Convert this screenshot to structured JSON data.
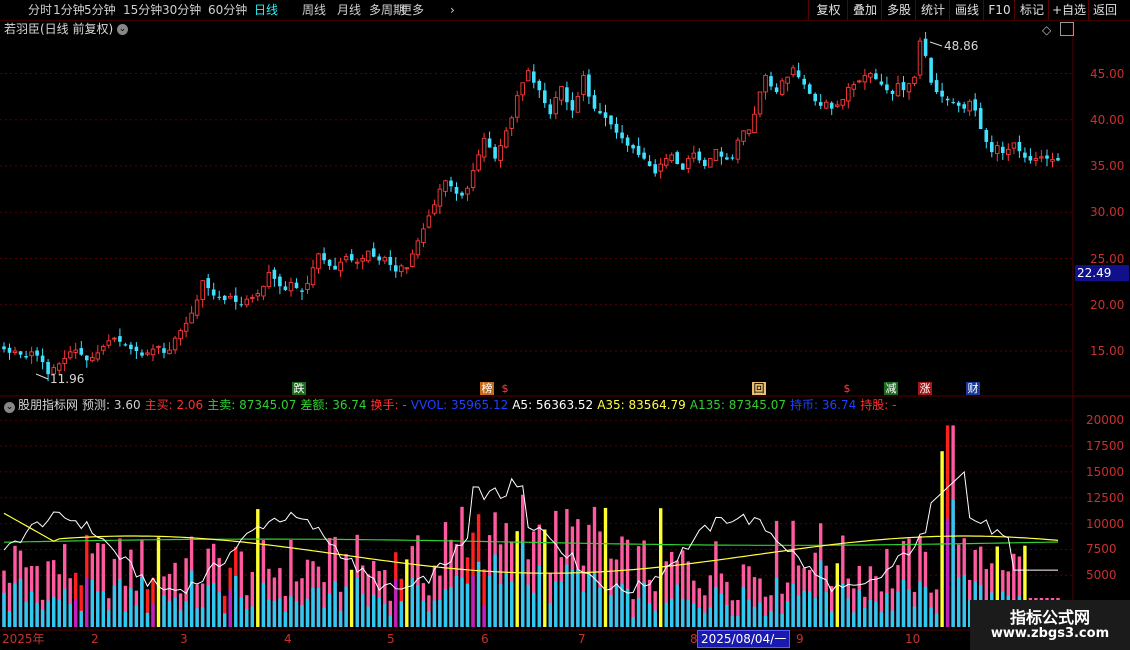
{
  "toolbar": {
    "left": [
      "分时",
      "1分钟",
      "5分钟",
      "15分钟",
      "30分钟",
      "60分钟",
      "日线",
      "周线",
      "月线",
      "多周期",
      "更多"
    ],
    "active": "日线",
    "right": [
      "复权",
      "叠加",
      "多股",
      "统计",
      "画线",
      "F10",
      "标记",
      "+自选",
      "返回"
    ]
  },
  "main_panel": {
    "title": "若羽臣(日线 前复权)",
    "y_ticks": [
      "45.00",
      "40.00",
      "35.00",
      "30.00",
      "25.00",
      "20.00",
      "15.00"
    ],
    "high_label": "48.86",
    "low_label": "11.96",
    "current_price": "22.49",
    "events": [
      {
        "text": "跌",
        "bg": "#1e6b1e",
        "fg": "#ffffff"
      },
      {
        "text": "榜",
        "bg": "#c46a1a",
        "fg": "#ffffff"
      },
      {
        "text": "$",
        "bg": "",
        "fg": "#ff4040"
      },
      {
        "text": "回",
        "bg": "#e8c070",
        "fg": "#000000"
      },
      {
        "text": "$",
        "bg": "",
        "fg": "#ff4040"
      },
      {
        "text": "减",
        "bg": "#1e6b1e",
        "fg": "#ffffff"
      },
      {
        "text": "涨",
        "bg": "#a01818",
        "fg": "#ffffff"
      },
      {
        "text": "财",
        "bg": "#1a3a9a",
        "fg": "#ffffff"
      }
    ]
  },
  "indicator_panel": {
    "name": "股朋指标网",
    "fields": [
      {
        "label": "预测:",
        "value": "3.60",
        "color": "#d0d0d0"
      },
      {
        "label": "主买:",
        "value": "2.06",
        "color": "#ff3030"
      },
      {
        "label": "主卖:",
        "value": "87345.07",
        "color": "#30d030"
      },
      {
        "label": "差额:",
        "value": "36.74",
        "color": "#30d030"
      },
      {
        "label": "换手:",
        "value": "-",
        "color": "#ff3030"
      },
      {
        "label": "VVOL:",
        "value": "35965.12",
        "color": "#2040ff"
      },
      {
        "label": "A5:",
        "value": "56363.52",
        "color": "#ffffff"
      },
      {
        "label": "A35:",
        "value": "83564.79",
        "color": "#ffff40"
      },
      {
        "label": "A135:",
        "value": "87345.07",
        "color": "#30d030"
      },
      {
        "label": "持币:",
        "value": "36.74",
        "color": "#2040ff"
      },
      {
        "label": "持股:",
        "value": "-",
        "color": "#ff3030"
      }
    ],
    "y_ticks": [
      "20000",
      "17500",
      "15000",
      "12500",
      "10000",
      "7500",
      "5000"
    ]
  },
  "x_axis": {
    "labels": [
      "2025年",
      "2",
      "3",
      "4",
      "5",
      "6",
      "7",
      "8",
      "9",
      "10"
    ],
    "cursor_date": "2025/08/04/一"
  },
  "watermark": {
    "line1": "指标公式网",
    "line2": "www.zbgs3.com"
  },
  "colors": {
    "up": "#ff3a3a",
    "down": "#40e0ff",
    "grid": "#5a0000",
    "axis_text": "#c83030"
  },
  "chart_data": {
    "type": "candlestick",
    "closes": [
      15.2,
      14.8,
      15.0,
      14.6,
      14.3,
      14.9,
      14.5,
      13.8,
      12.5,
      13.2,
      13.6,
      14.2,
      14.9,
      15.1,
      14.6,
      14.0,
      14.3,
      14.8,
      15.5,
      16.1,
      16.4,
      16.0,
      15.6,
      15.2,
      15.0,
      14.5,
      14.8,
      15.2,
      15.5,
      14.8,
      15.1,
      16.4,
      17.2,
      18.0,
      19.1,
      20.5,
      22.6,
      21.8,
      21.0,
      20.8,
      20.5,
      20.9,
      20.3,
      20.0,
      20.6,
      20.8,
      21.2,
      22.0,
      23.5,
      22.8,
      22.0,
      21.6,
      22.4,
      21.8,
      21.4,
      22.3,
      24.0,
      25.5,
      24.8,
      24.2,
      23.8,
      24.6,
      25.2,
      24.8,
      24.6,
      25.0,
      25.8,
      25.2,
      24.8,
      25.1,
      24.3,
      23.6,
      24.2,
      24.0,
      25.5,
      26.9,
      28.2,
      29.6,
      30.8,
      32.5,
      33.4,
      32.8,
      32.0,
      31.8,
      32.6,
      34.5,
      36.2,
      38.0,
      37.0,
      35.8,
      37.2,
      38.8,
      40.2,
      42.6,
      44.0,
      45.3,
      44.0,
      43.2,
      41.8,
      40.6,
      42.4,
      43.6,
      41.9,
      41.0,
      42.5,
      44.8,
      42.5,
      41.2,
      40.7,
      40.2,
      39.5,
      38.6,
      38.0,
      37.2,
      36.9,
      36.2,
      35.8,
      35.0,
      34.2,
      35.2,
      35.8,
      36.2,
      35.2,
      34.6,
      35.8,
      36.4,
      35.6,
      35.0,
      35.8,
      36.8,
      36.0,
      35.7,
      35.8,
      37.8,
      38.8,
      38.9,
      40.6,
      43.0,
      44.8,
      43.6,
      43.0,
      44.2,
      44.6,
      45.6,
      44.6,
      43.8,
      42.8,
      42.0,
      41.5,
      41.9,
      41.2,
      41.6,
      42.2,
      43.5,
      43.8,
      44.2,
      44.8,
      45.0,
      44.4,
      43.8,
      43.2,
      42.8,
      43.9,
      43.2,
      43.9,
      44.6,
      48.5,
      46.9,
      44.0,
      43.0,
      42.5,
      42.1,
      41.9,
      41.5,
      41.2,
      42.0,
      41.0,
      39.0,
      37.6,
      36.5,
      37.2,
      36.4,
      36.8,
      37.5,
      36.6,
      35.9,
      35.6,
      35.8,
      36.0,
      35.8,
      35.7,
      35.6
    ]
  }
}
